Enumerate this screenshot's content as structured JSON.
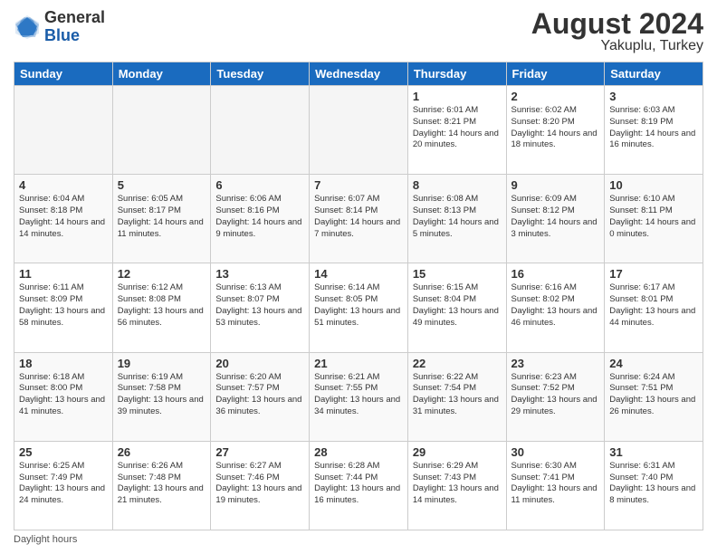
{
  "header": {
    "logo_general": "General",
    "logo_blue": "Blue",
    "month_year": "August 2024",
    "location": "Yakuplu, Turkey"
  },
  "weekdays": [
    "Sunday",
    "Monday",
    "Tuesday",
    "Wednesday",
    "Thursday",
    "Friday",
    "Saturday"
  ],
  "weeks": [
    [
      {
        "day": "",
        "info": ""
      },
      {
        "day": "",
        "info": ""
      },
      {
        "day": "",
        "info": ""
      },
      {
        "day": "",
        "info": ""
      },
      {
        "day": "1",
        "info": "Sunrise: 6:01 AM\nSunset: 8:21 PM\nDaylight: 14 hours\nand 20 minutes."
      },
      {
        "day": "2",
        "info": "Sunrise: 6:02 AM\nSunset: 8:20 PM\nDaylight: 14 hours\nand 18 minutes."
      },
      {
        "day": "3",
        "info": "Sunrise: 6:03 AM\nSunset: 8:19 PM\nDaylight: 14 hours\nand 16 minutes."
      }
    ],
    [
      {
        "day": "4",
        "info": "Sunrise: 6:04 AM\nSunset: 8:18 PM\nDaylight: 14 hours\nand 14 minutes."
      },
      {
        "day": "5",
        "info": "Sunrise: 6:05 AM\nSunset: 8:17 PM\nDaylight: 14 hours\nand 11 minutes."
      },
      {
        "day": "6",
        "info": "Sunrise: 6:06 AM\nSunset: 8:16 PM\nDaylight: 14 hours\nand 9 minutes."
      },
      {
        "day": "7",
        "info": "Sunrise: 6:07 AM\nSunset: 8:14 PM\nDaylight: 14 hours\nand 7 minutes."
      },
      {
        "day": "8",
        "info": "Sunrise: 6:08 AM\nSunset: 8:13 PM\nDaylight: 14 hours\nand 5 minutes."
      },
      {
        "day": "9",
        "info": "Sunrise: 6:09 AM\nSunset: 8:12 PM\nDaylight: 14 hours\nand 3 minutes."
      },
      {
        "day": "10",
        "info": "Sunrise: 6:10 AM\nSunset: 8:11 PM\nDaylight: 14 hours\nand 0 minutes."
      }
    ],
    [
      {
        "day": "11",
        "info": "Sunrise: 6:11 AM\nSunset: 8:09 PM\nDaylight: 13 hours\nand 58 minutes."
      },
      {
        "day": "12",
        "info": "Sunrise: 6:12 AM\nSunset: 8:08 PM\nDaylight: 13 hours\nand 56 minutes."
      },
      {
        "day": "13",
        "info": "Sunrise: 6:13 AM\nSunset: 8:07 PM\nDaylight: 13 hours\nand 53 minutes."
      },
      {
        "day": "14",
        "info": "Sunrise: 6:14 AM\nSunset: 8:05 PM\nDaylight: 13 hours\nand 51 minutes."
      },
      {
        "day": "15",
        "info": "Sunrise: 6:15 AM\nSunset: 8:04 PM\nDaylight: 13 hours\nand 49 minutes."
      },
      {
        "day": "16",
        "info": "Sunrise: 6:16 AM\nSunset: 8:02 PM\nDaylight: 13 hours\nand 46 minutes."
      },
      {
        "day": "17",
        "info": "Sunrise: 6:17 AM\nSunset: 8:01 PM\nDaylight: 13 hours\nand 44 minutes."
      }
    ],
    [
      {
        "day": "18",
        "info": "Sunrise: 6:18 AM\nSunset: 8:00 PM\nDaylight: 13 hours\nand 41 minutes."
      },
      {
        "day": "19",
        "info": "Sunrise: 6:19 AM\nSunset: 7:58 PM\nDaylight: 13 hours\nand 39 minutes."
      },
      {
        "day": "20",
        "info": "Sunrise: 6:20 AM\nSunset: 7:57 PM\nDaylight: 13 hours\nand 36 minutes."
      },
      {
        "day": "21",
        "info": "Sunrise: 6:21 AM\nSunset: 7:55 PM\nDaylight: 13 hours\nand 34 minutes."
      },
      {
        "day": "22",
        "info": "Sunrise: 6:22 AM\nSunset: 7:54 PM\nDaylight: 13 hours\nand 31 minutes."
      },
      {
        "day": "23",
        "info": "Sunrise: 6:23 AM\nSunset: 7:52 PM\nDaylight: 13 hours\nand 29 minutes."
      },
      {
        "day": "24",
        "info": "Sunrise: 6:24 AM\nSunset: 7:51 PM\nDaylight: 13 hours\nand 26 minutes."
      }
    ],
    [
      {
        "day": "25",
        "info": "Sunrise: 6:25 AM\nSunset: 7:49 PM\nDaylight: 13 hours\nand 24 minutes."
      },
      {
        "day": "26",
        "info": "Sunrise: 6:26 AM\nSunset: 7:48 PM\nDaylight: 13 hours\nand 21 minutes."
      },
      {
        "day": "27",
        "info": "Sunrise: 6:27 AM\nSunset: 7:46 PM\nDaylight: 13 hours\nand 19 minutes."
      },
      {
        "day": "28",
        "info": "Sunrise: 6:28 AM\nSunset: 7:44 PM\nDaylight: 13 hours\nand 16 minutes."
      },
      {
        "day": "29",
        "info": "Sunrise: 6:29 AM\nSunset: 7:43 PM\nDaylight: 13 hours\nand 14 minutes."
      },
      {
        "day": "30",
        "info": "Sunrise: 6:30 AM\nSunset: 7:41 PM\nDaylight: 13 hours\nand 11 minutes."
      },
      {
        "day": "31",
        "info": "Sunrise: 6:31 AM\nSunset: 7:40 PM\nDaylight: 13 hours\nand 8 minutes."
      }
    ]
  ],
  "footer": "Daylight hours"
}
